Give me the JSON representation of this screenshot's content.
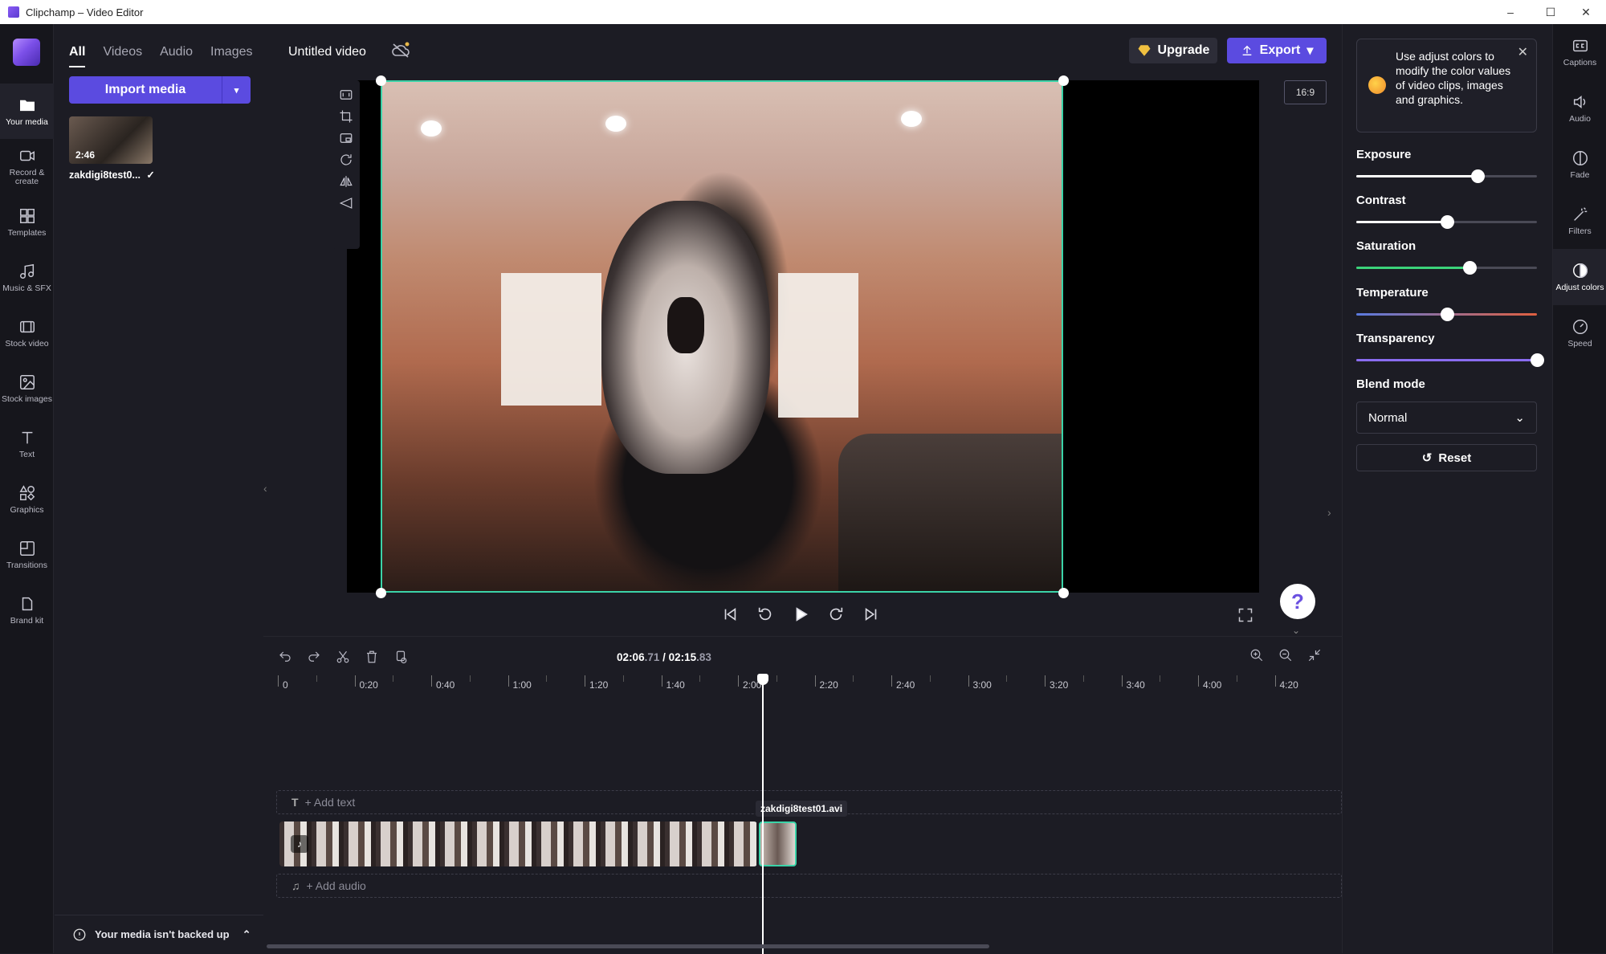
{
  "window": {
    "title": "Clipchamp – Video Editor",
    "minimize": "–",
    "maximize": "☐",
    "close": "✕"
  },
  "leftnav": {
    "items": [
      {
        "label": "Your media",
        "icon": "folder-icon"
      },
      {
        "label": "Record & create",
        "icon": "camera-icon"
      },
      {
        "label": "Templates",
        "icon": "templates-icon"
      },
      {
        "label": "Music & SFX",
        "icon": "music-icon"
      },
      {
        "label": "Stock video",
        "icon": "film-icon"
      },
      {
        "label": "Stock images",
        "icon": "image-icon"
      },
      {
        "label": "Text",
        "icon": "text-icon"
      },
      {
        "label": "Graphics",
        "icon": "shapes-icon"
      },
      {
        "label": "Transitions",
        "icon": "transitions-icon"
      },
      {
        "label": "Brand kit",
        "icon": "brand-icon"
      }
    ]
  },
  "media": {
    "tabs": [
      "All",
      "Videos",
      "Audio",
      "Images"
    ],
    "import_label": "Import media",
    "items": [
      {
        "name": "zakdigi8test0...",
        "duration": "2:46",
        "check": "✓"
      }
    ],
    "backup_message": "Your media isn't backed up"
  },
  "editor": {
    "project_title": "Untitled video",
    "upgrade_label": "Upgrade",
    "export_label": "Export",
    "aspect_ratio": "16:9",
    "help": "?"
  },
  "timeline": {
    "current_time_main": "02:06",
    "current_time_frac": ".71",
    "separator": " / ",
    "total_time_main": "02:15",
    "total_time_frac": ".83",
    "ticks": [
      "0",
      "0:20",
      "0:40",
      "1:00",
      "1:20",
      "1:40",
      "2:00",
      "2:20",
      "2:40",
      "3:00",
      "3:20",
      "3:40",
      "4:00",
      "4:20"
    ],
    "add_text_label": "+ Add text",
    "add_audio_label": "+ Add audio",
    "clip_label": "zakdigi8test01.avi"
  },
  "adjust": {
    "tip": "Use adjust colors to modify the color values of video clips, images and graphics.",
    "sliders": [
      {
        "label": "Exposure",
        "value": 0.67,
        "color": "#ffffff"
      },
      {
        "label": "Contrast",
        "value": 0.5,
        "color": "#ffffff"
      },
      {
        "label": "Saturation",
        "value": 0.625,
        "color": "#3bd37a"
      },
      {
        "label": "Temperature",
        "value": 0.5,
        "color": "#e06040"
      },
      {
        "label": "Transparency",
        "value": 1.0,
        "color": "#8a6cf0"
      }
    ],
    "blend_label": "Blend mode",
    "blend_value": "Normal",
    "reset_label": "Reset"
  },
  "rightnav": {
    "items": [
      {
        "label": "Captions",
        "icon": "captions-icon"
      },
      {
        "label": "Audio",
        "icon": "speaker-icon"
      },
      {
        "label": "Fade",
        "icon": "fade-icon"
      },
      {
        "label": "Filters",
        "icon": "wand-icon"
      },
      {
        "label": "Adjust colors",
        "icon": "contrast-icon"
      },
      {
        "label": "Speed",
        "icon": "speedometer-icon"
      }
    ]
  },
  "colors": {
    "accent": "#5b4be0",
    "selection": "#3bd3a8"
  }
}
